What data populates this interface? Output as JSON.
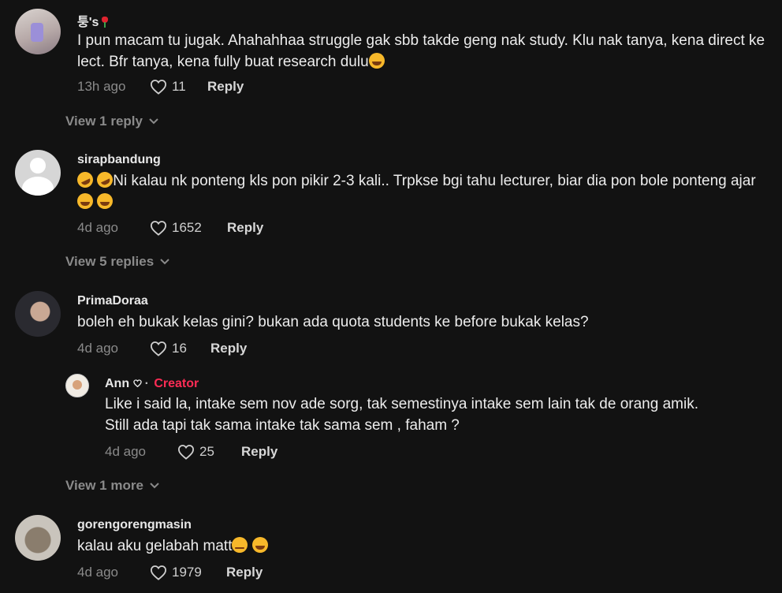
{
  "comments": [
    {
      "username": "퉁's",
      "text": "I pun macam tu jugak. Ahahahhaa struggle gak sbb takde geng nak study. Klu nak tanya, kena direct ke lect. Bfr tanya, kena fully buat research dulu",
      "time": "13h ago",
      "likes": "11",
      "reply_label": "Reply",
      "view_replies": "View 1 reply"
    },
    {
      "username": "sirapbandung",
      "text_part1": "Ni kalau nk ponteng kls pon pikir 2-3 kali.. Trpkse bgi tahu lecturer, biar dia pon bole ponteng ajar",
      "time": "4d ago",
      "likes": "1652",
      "reply_label": "Reply",
      "view_replies": "View 5 replies"
    },
    {
      "username": "PrimaDoraa",
      "text": "boleh eh bukak kelas gini? bukan ada quota students ke before bukak kelas?",
      "time": "4d ago",
      "likes": "16",
      "reply_label": "Reply",
      "view_replies": "View 1 more"
    },
    {
      "username": "gorengorengmasin",
      "text": "kalau aku gelabah matt",
      "time": "4d ago",
      "likes": "1979",
      "reply_label": "Reply"
    }
  ],
  "reply": {
    "username": "Ann",
    "separator": "·",
    "badge": "Creator",
    "text": "Like i said la, intake sem nov ade sorg, tak semestinya intake sem lain tak de orang amik.\nStill ada tapi tak sama intake tak sama sem , faham ?",
    "time": "4d ago",
    "likes": "25",
    "reply_label": "Reply"
  },
  "colors": {
    "background": "#121212",
    "creator_badge": "#fe2c55",
    "muted_text": "#8a8a8a"
  },
  "icons": [
    "heart-icon",
    "chevron-down-icon",
    "rose-emoji",
    "laughing-emoji",
    "rofl-emoji",
    "crying-emoji",
    "pensive-emoji",
    "heart-small-icon"
  ]
}
